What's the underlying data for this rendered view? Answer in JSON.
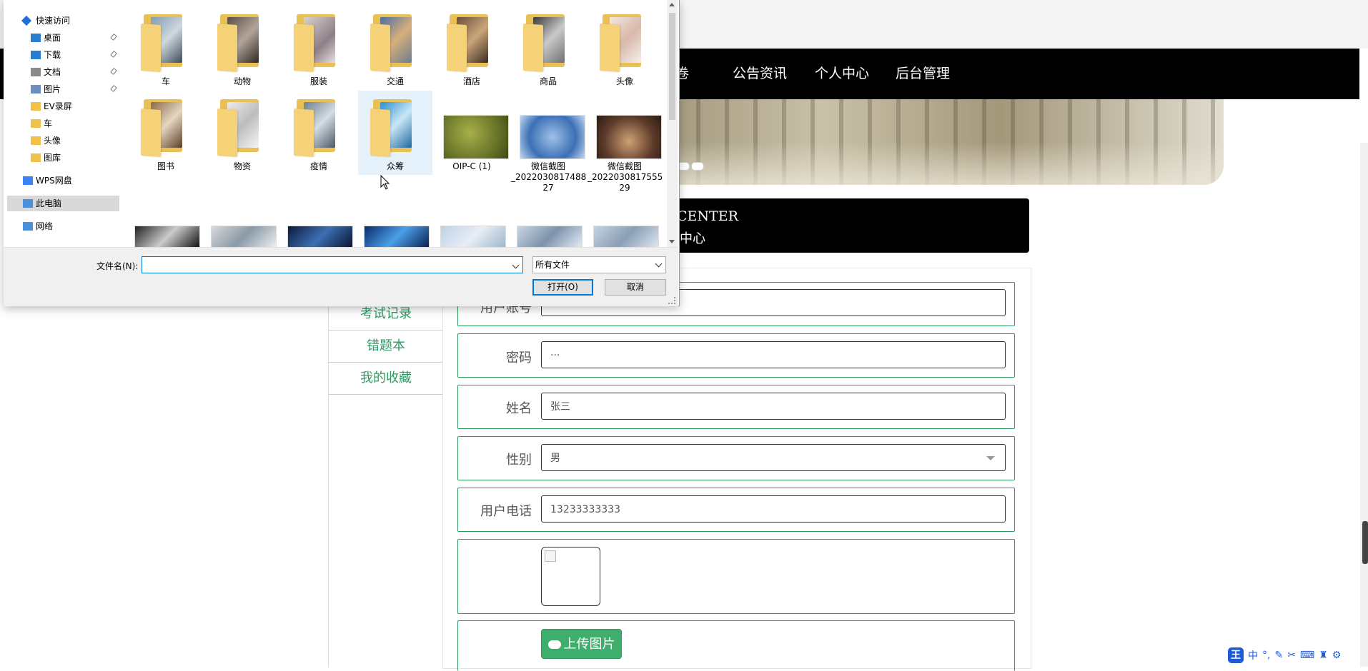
{
  "nav": {
    "items": [
      {
        "label": "卷"
      },
      {
        "label": "公告资讯"
      },
      {
        "label": "个人中心"
      },
      {
        "label": "后台管理"
      }
    ]
  },
  "center": {
    "title_en": "CENTER",
    "title_cn": "中心"
  },
  "sidebar": {
    "items": [
      {
        "label": "考试记录"
      },
      {
        "label": "错题本"
      },
      {
        "label": "我的收藏"
      }
    ]
  },
  "form": {
    "account": {
      "label": "用户账号",
      "value": "···"
    },
    "password": {
      "label": "密码",
      "value": "···"
    },
    "name": {
      "label": "姓名",
      "value": "张三"
    },
    "gender": {
      "label": "性别",
      "value": "男"
    },
    "phone": {
      "label": "用户电话",
      "value": "13233333333"
    },
    "upload_label": "上传图片"
  },
  "ime": {
    "logo": "王",
    "mode": "中"
  },
  "dialog": {
    "nav_pane": [
      {
        "label": "快速访问",
        "icon": "star-icon"
      },
      {
        "label": "桌面",
        "icon": "desktop-icon",
        "pinned": true
      },
      {
        "label": "下载",
        "icon": "download-icon",
        "pinned": true
      },
      {
        "label": "文档",
        "icon": "document-icon",
        "pinned": true
      },
      {
        "label": "图片",
        "icon": "picture-icon",
        "pinned": true
      },
      {
        "label": "EV录屏",
        "icon": "folder-icon"
      },
      {
        "label": "车",
        "icon": "folder-icon"
      },
      {
        "label": "头像",
        "icon": "folder-icon"
      },
      {
        "label": "图库",
        "icon": "folder-icon"
      },
      {
        "label": "WPS网盘",
        "icon": "cloud-icon"
      },
      {
        "label": "此电脑",
        "icon": "computer-icon",
        "selected": true
      },
      {
        "label": "网络",
        "icon": "network-icon"
      }
    ],
    "files_row1": [
      "车",
      "动物",
      "服装",
      "交通",
      "酒店",
      "商品",
      "头像"
    ],
    "files_row2": [
      "图书",
      "物资",
      "疫情",
      "众筹",
      "OIP-C (1)",
      "微信截图_20220308174827",
      "微信截图_20220308175529"
    ],
    "files_row2_display": [
      [
        "图书"
      ],
      [
        "物资"
      ],
      [
        "疫情"
      ],
      [
        "众筹"
      ],
      [
        "OIP-C (1)"
      ],
      [
        "微信截图",
        "_2022030817488",
        "27"
      ],
      [
        "微信截图",
        "_2022030817555",
        "29"
      ]
    ],
    "filename_label": "文件名(N):",
    "filename_value": "",
    "filetype": "所有文件",
    "open_button": "打开(O)",
    "cancel_button": "取消"
  },
  "colors": {
    "accent_green": "#2e9a63",
    "nav_bg": "#000000",
    "dialog_focus": "#0078d7"
  }
}
